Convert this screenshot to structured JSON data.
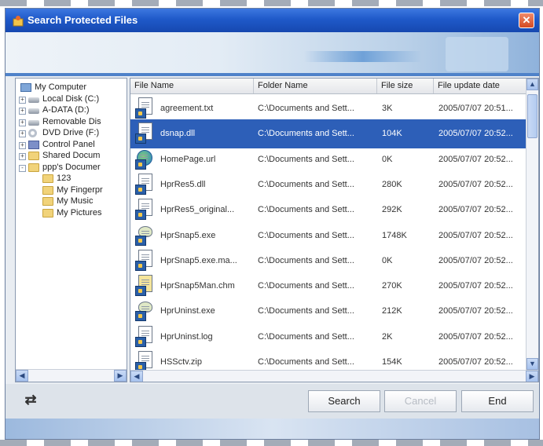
{
  "window": {
    "title": "Search Protected Files"
  },
  "tree": {
    "items": [
      {
        "label": "My Computer",
        "icon": "computer-icon",
        "expander": ""
      },
      {
        "label": "Local Disk (C:)",
        "icon": "hard-drive-icon",
        "expander": "+"
      },
      {
        "label": "A-DATA (D:)",
        "icon": "hard-drive-icon",
        "expander": "+"
      },
      {
        "label": "Removable Dis",
        "icon": "removable-drive-icon",
        "expander": "+"
      },
      {
        "label": "DVD Drive (F:)",
        "icon": "dvd-drive-icon",
        "expander": "+"
      },
      {
        "label": "Control Panel",
        "icon": "control-panel-icon",
        "expander": "+"
      },
      {
        "label": "Shared Docum",
        "icon": "folder-icon",
        "expander": "+"
      },
      {
        "label": "ppp's Documer",
        "icon": "folder-icon",
        "expander": "-"
      },
      {
        "label": "123",
        "icon": "folder-icon",
        "expander": ""
      },
      {
        "label": "My Fingerpr",
        "icon": "folder-icon",
        "expander": ""
      },
      {
        "label": "My Music",
        "icon": "folder-icon",
        "expander": ""
      },
      {
        "label": "My Pictures",
        "icon": "folder-icon",
        "expander": ""
      }
    ]
  },
  "list": {
    "columns": [
      "File Name",
      "Folder Name",
      "File size",
      "File update date"
    ],
    "rows": [
      {
        "name": "agreement.txt",
        "folder": "C:\\Documents and Sett...",
        "size": "3K",
        "date": "2005/07/07 20:51...",
        "icon": "text-file-icon",
        "selected": false
      },
      {
        "name": "dsnap.dll",
        "folder": "C:\\Documents and Sett...",
        "size": "104K",
        "date": "2005/07/07 20:52...",
        "icon": "dll-file-icon",
        "selected": true
      },
      {
        "name": "HomePage.url",
        "folder": "C:\\Documents and Sett...",
        "size": "0K",
        "date": "2005/07/07 20:52...",
        "icon": "url-file-icon",
        "selected": false
      },
      {
        "name": "HprRes5.dll",
        "folder": "C:\\Documents and Sett...",
        "size": "280K",
        "date": "2005/07/07 20:52...",
        "icon": "dll-file-icon",
        "selected": false
      },
      {
        "name": "HprRes5_original...",
        "folder": "C:\\Documents and Sett...",
        "size": "292K",
        "date": "2005/07/07 20:52...",
        "icon": "dll-file-icon",
        "selected": false
      },
      {
        "name": "HprSnap5.exe",
        "folder": "C:\\Documents and Sett...",
        "size": "1748K",
        "date": "2005/07/07 20:52...",
        "icon": "exe-file-icon",
        "selected": false
      },
      {
        "name": "HprSnap5.exe.ma...",
        "folder": "C:\\Documents and Sett...",
        "size": "0K",
        "date": "2005/07/07 20:52...",
        "icon": "generic-file-icon",
        "selected": false
      },
      {
        "name": "HprSnap5Man.chm",
        "folder": "C:\\Documents and Sett...",
        "size": "270K",
        "date": "2005/07/07 20:52...",
        "icon": "help-file-icon",
        "selected": false
      },
      {
        "name": "HprUninst.exe",
        "folder": "C:\\Documents and Sett...",
        "size": "212K",
        "date": "2005/07/07 20:52...",
        "icon": "exe-file-icon",
        "selected": false
      },
      {
        "name": "HprUninst.log",
        "folder": "C:\\Documents and Sett...",
        "size": "2K",
        "date": "2005/07/07 20:52...",
        "icon": "text-file-icon",
        "selected": false
      },
      {
        "name": "HSSctv.zip",
        "folder": "C:\\Documents and Sett...",
        "size": "154K",
        "date": "2005/07/07 20:52...",
        "icon": "zip-file-icon",
        "selected": false
      }
    ]
  },
  "buttons": {
    "search": "Search",
    "cancel": "Cancel",
    "end": "End"
  },
  "colors": {
    "selection": "#2d5fb8",
    "titlebar": "#1f59c9",
    "close": "#d44a22"
  }
}
